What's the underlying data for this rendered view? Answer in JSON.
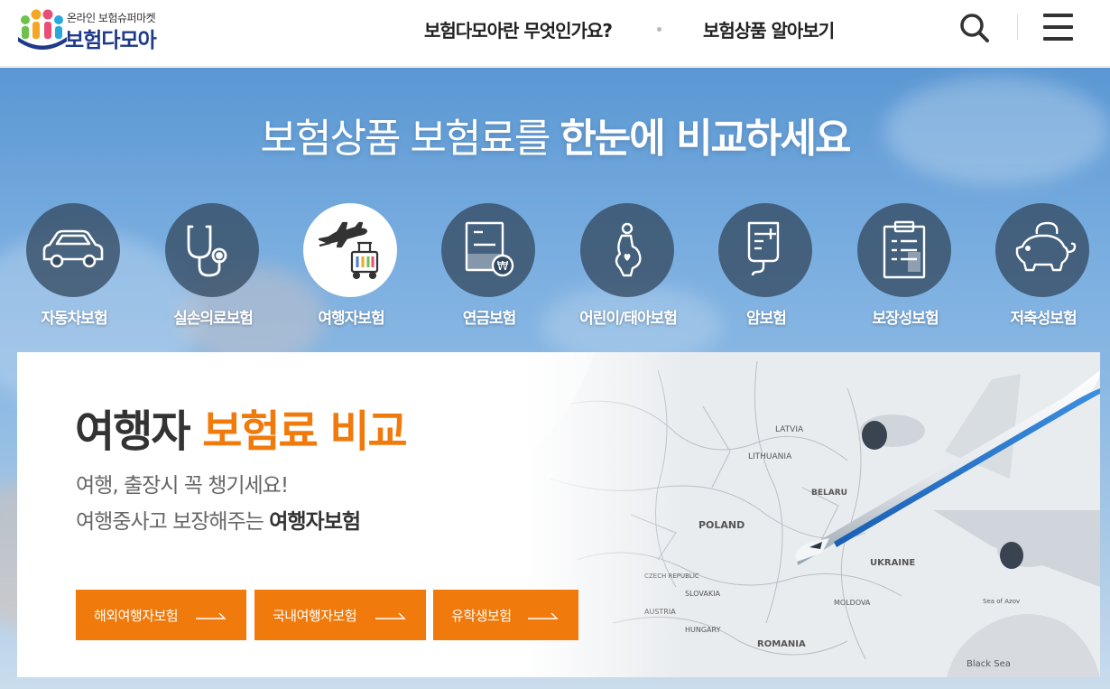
{
  "header": {
    "logo_sub": "온라인 보험슈퍼마켓",
    "logo_main": "보험다모아",
    "nav": [
      "보험다모아란 무엇인가요?",
      "보험상품 알아보기"
    ]
  },
  "hero": {
    "title_light": "보험상품 보험료를 ",
    "title_bold": "한눈에 비교하세요",
    "categories": [
      {
        "label": "자동차보험",
        "icon": "car-icon"
      },
      {
        "label": "실손의료보험",
        "icon": "stethoscope-icon"
      },
      {
        "label": "여행자보험",
        "icon": "airplane-luggage-icon",
        "active": true
      },
      {
        "label": "연금보험",
        "icon": "pension-document-icon"
      },
      {
        "label": "어린이/태아보험",
        "icon": "pregnant-mother-icon"
      },
      {
        "label": "암보험",
        "icon": "iv-bag-icon"
      },
      {
        "label": "보장성보험",
        "icon": "clipboard-icon"
      },
      {
        "label": "저축성보험",
        "icon": "piggy-bank-icon"
      }
    ]
  },
  "panel": {
    "title_dark": "여행자 ",
    "title_orange": "보험료 비교",
    "desc_line1": "여행, 출장시 꼭 챙기세요!",
    "desc_line2_prefix": "여행중사고 보장해주는 ",
    "desc_line2_bold": "여행자보험",
    "buttons": [
      "해외여행자보험",
      "국내여행자보험",
      "유학생보험"
    ],
    "map_labels": [
      "LATVIA",
      "LITHUANIA",
      "BELARU",
      "POLAND",
      "UKRAINE",
      "SLOVAKIA",
      "HUNGARY",
      "ROMANIA",
      "Black Sea",
      "CZECH REPUBLIC",
      "MOLDOVA",
      "AUSTRIA",
      "Sea of Azov"
    ]
  },
  "colors": {
    "accent": "#f07a0b",
    "brand_navy": "#1f3a8a",
    "hero_blue": "#5a97d3"
  }
}
